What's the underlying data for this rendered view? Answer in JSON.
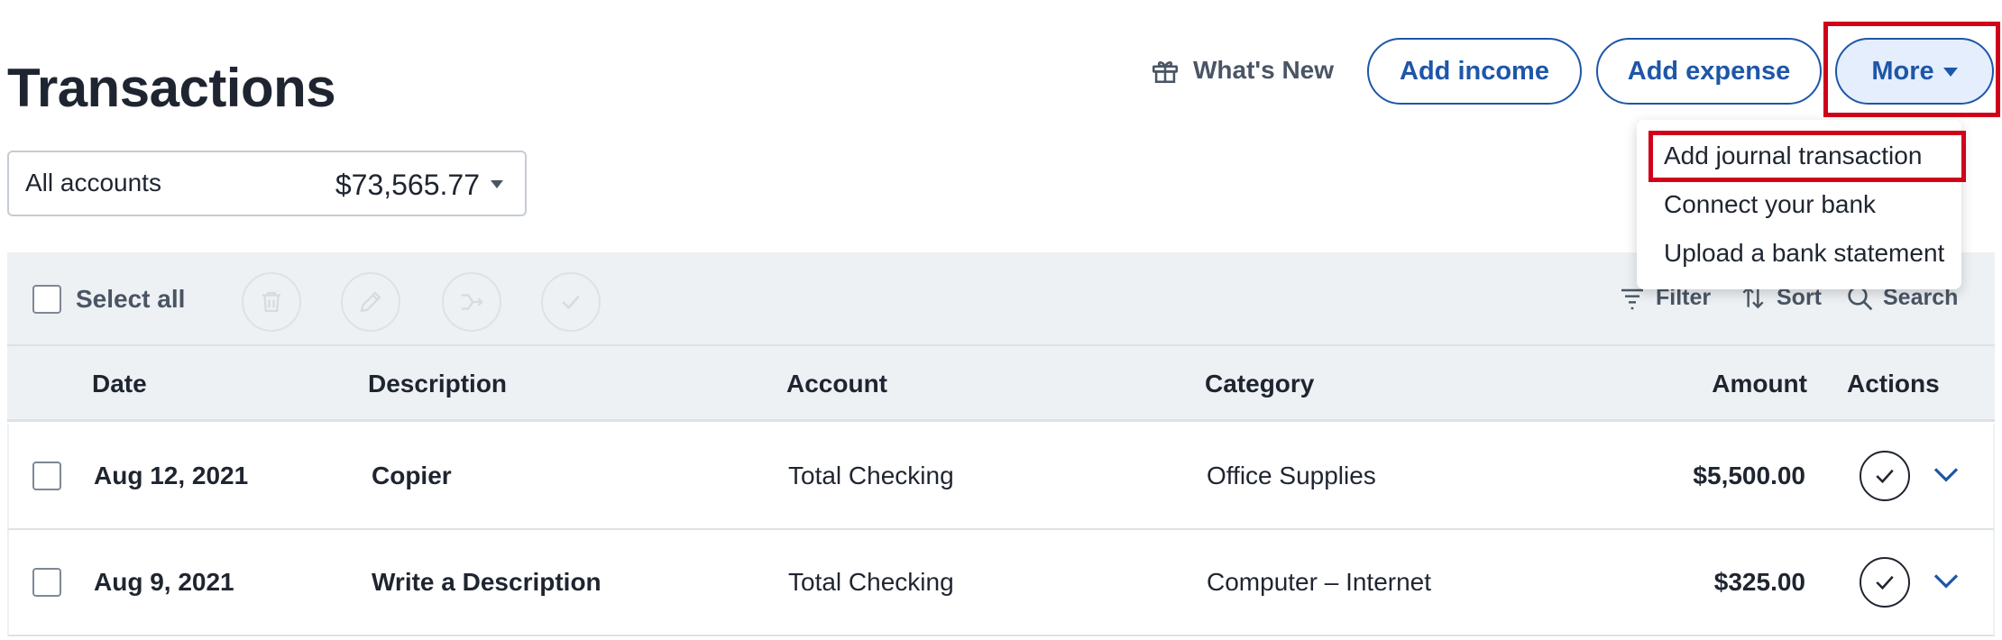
{
  "header": {
    "title": "Transactions",
    "whats_new": "What's New",
    "add_income": "Add income",
    "add_expense": "Add expense",
    "more": "More"
  },
  "more_menu": {
    "items": [
      "Add journal transaction",
      "Connect your bank",
      "Upload a bank statement"
    ]
  },
  "account_selector": {
    "label": "All accounts",
    "amount": "$73,565.77"
  },
  "toolbar": {
    "select_all": "Select all",
    "filter": "Filter",
    "sort": "Sort",
    "search": "Search"
  },
  "table": {
    "columns": [
      "Date",
      "Description",
      "Account",
      "Category",
      "Amount",
      "Actions"
    ],
    "rows": [
      {
        "date": "Aug 12, 2021",
        "description": "Copier",
        "account": "Total Checking",
        "category": "Office Supplies",
        "amount": "$5,500.00"
      },
      {
        "date": "Aug 9, 2021",
        "description": "Write a Description",
        "account": "Total Checking",
        "category": "Computer – Internet",
        "amount": "$325.00"
      }
    ]
  },
  "colors": {
    "accent": "#1e56a8",
    "highlight": "#d0021b",
    "toolbar_bg": "#edf1f4"
  }
}
